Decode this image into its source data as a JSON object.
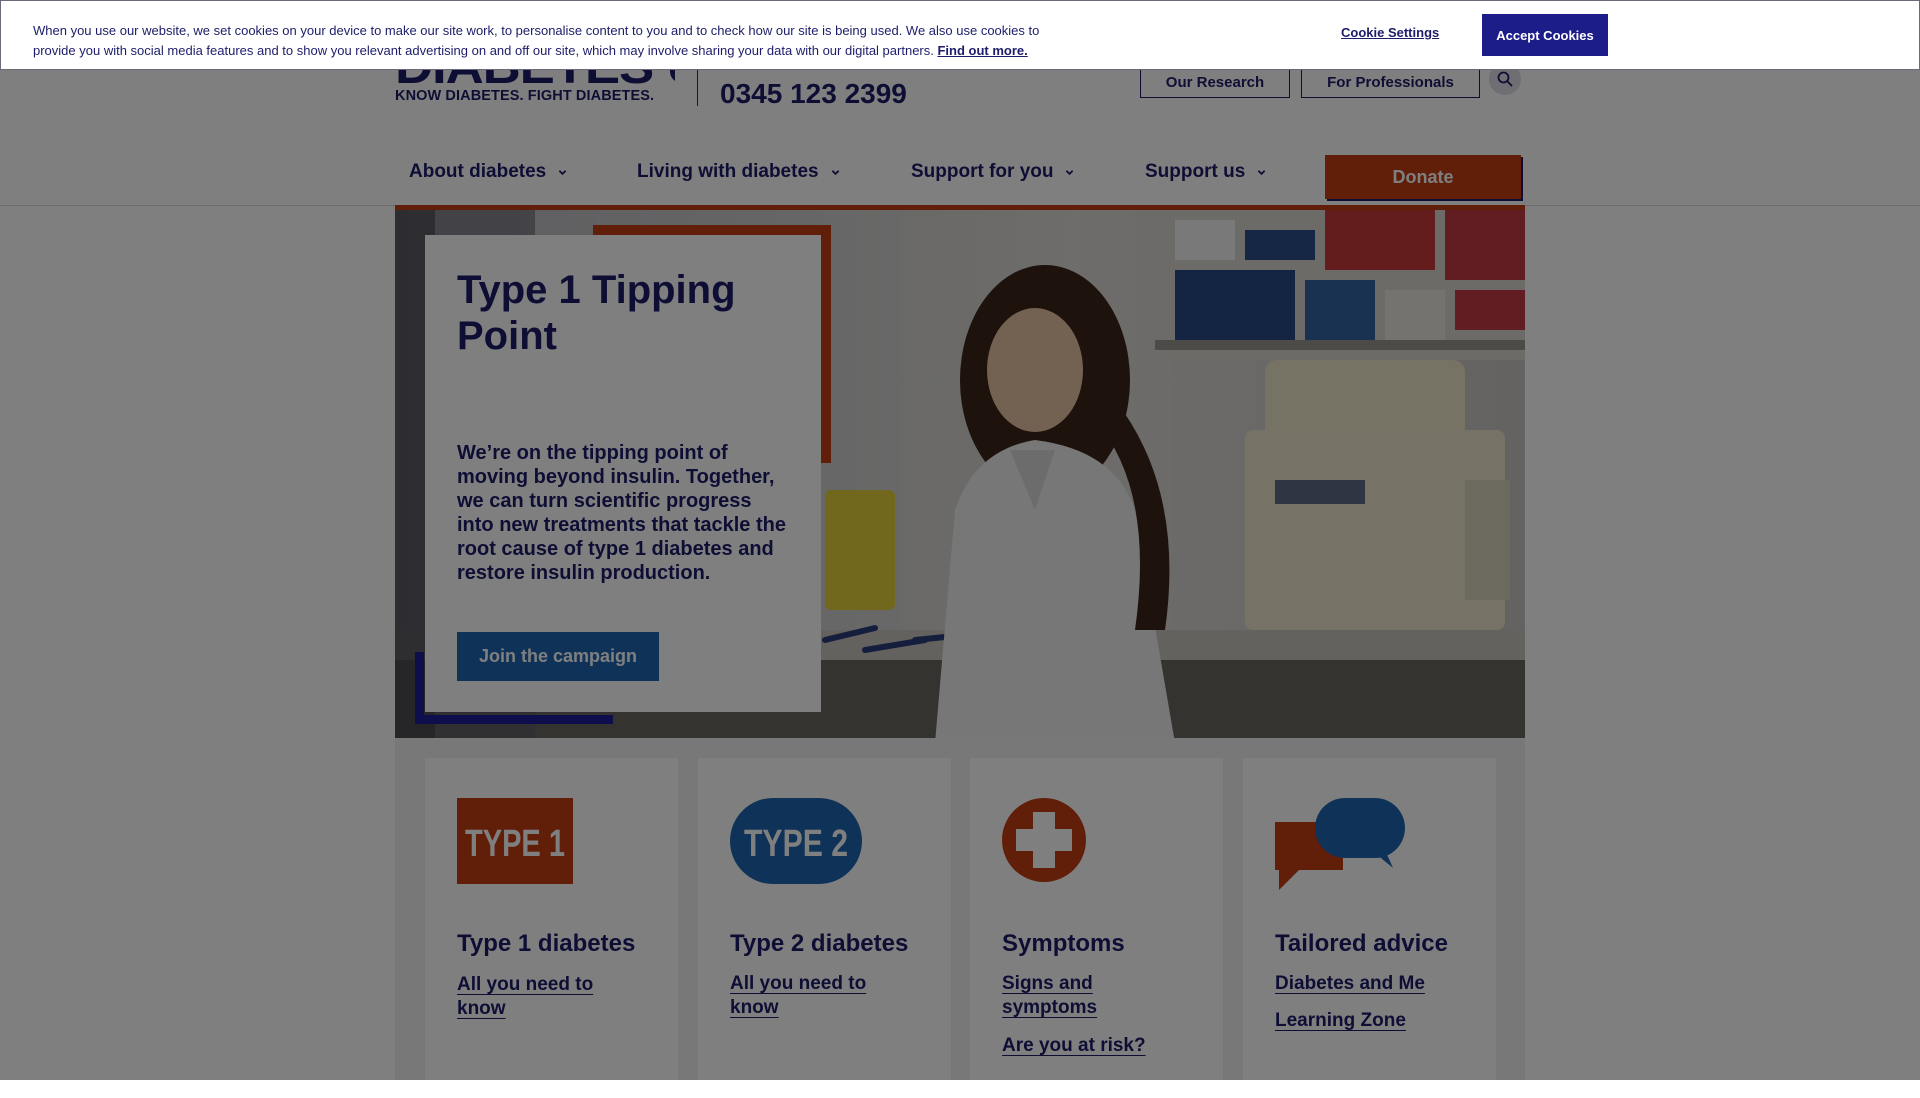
{
  "cookie_banner": {
    "text": "When you use our website, we set cookies on your device to make our site work, to personalise content to you and to check how our site is being used. We also use cookies to provide you with social media features and to show you relevant advertising on and off our site, which may involve sharing your data with our digital partners.",
    "find_out_more": "Find out more.",
    "settings_label": "Cookie Settings",
    "accept_label": "Accept Cookies"
  },
  "header": {
    "logo_text": "DIABETES UK",
    "strapline": "KNOW DIABETES. FIGHT DIABETES.",
    "phone": "0345 123 2399",
    "utility_links": [
      "Our Research",
      "For Professionals"
    ],
    "search_icon": "search-icon"
  },
  "nav": {
    "items": [
      "About diabetes",
      "Living with diabetes",
      "Support for you",
      "Support us"
    ],
    "donate_label": "Donate"
  },
  "hero": {
    "title": "Type 1 Tipping Point",
    "body": "We’re on the tipping point of moving beyond insulin. Together, we can turn scientific progress into new treatments that tackle the root cause of type 1 diabetes and restore insulin production.",
    "cta_label": "Join the campaign"
  },
  "cards": [
    {
      "icon": "type-1-icon",
      "icon_text": "TYPE 1",
      "title": "Type 1 diabetes",
      "links": [
        "All you need to know"
      ]
    },
    {
      "icon": "type-2-icon",
      "icon_text": "TYPE 2",
      "title": "Type 2 diabetes",
      "links": [
        "All you need to know"
      ]
    },
    {
      "icon": "medical-cross-icon",
      "title": "Symptoms",
      "links": [
        "Signs and symptoms",
        "Are you at risk?"
      ]
    },
    {
      "icon": "speech-bubbles-icon",
      "title": "Tailored advice",
      "links": [
        "Diabetes and Me",
        "Learning Zone"
      ]
    }
  ],
  "colors": {
    "navy": "#1d1d6b",
    "orange": "#c33d12",
    "blue": "#1f64b0",
    "accept_button": "#1d1d8a"
  }
}
